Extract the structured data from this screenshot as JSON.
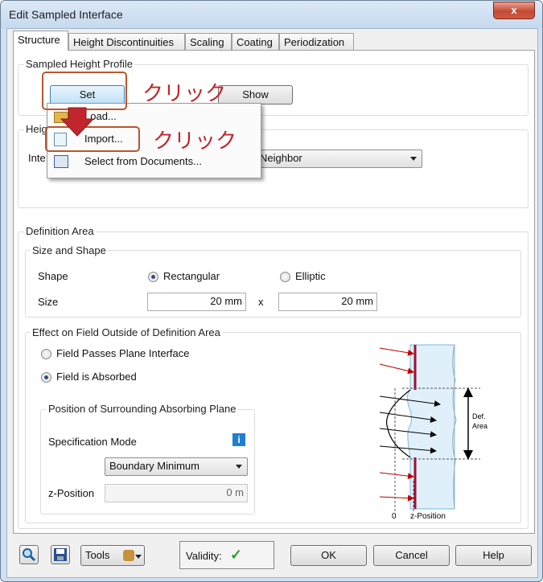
{
  "window": {
    "title": "Edit Sampled Interface",
    "close_glyph": "x"
  },
  "tabs": [
    {
      "label": "Structure"
    },
    {
      "label": "Height Discontinuities"
    },
    {
      "label": "Scaling"
    },
    {
      "label": "Coating"
    },
    {
      "label": "Periodization"
    }
  ],
  "sampled_profile": {
    "group_label": "Sampled Height Profile",
    "set_label": "Set",
    "show_label": "Show"
  },
  "height_group": {
    "label_partial": "Heig",
    "interp_label_partial": "Inte",
    "interp_value_partial": "Neighbor"
  },
  "context_menu": {
    "items": [
      {
        "label": "Load...",
        "icon": "folder-icon"
      },
      {
        "label": "Import...",
        "icon": "import-icon"
      },
      {
        "label": "Select from Documents...",
        "icon": "documents-icon"
      }
    ]
  },
  "annotations": {
    "click_text": "クリック",
    "highlight_color": "#b8562c",
    "text_color": "#c0262b"
  },
  "definition_area": {
    "group_label": "Definition Area",
    "size_shape_label": "Size and Shape",
    "shape_label": "Shape",
    "shape_options": [
      {
        "label": "Rectangular",
        "selected": true
      },
      {
        "label": "Elliptic",
        "selected": false
      }
    ],
    "size_label": "Size",
    "size_x": "20 mm",
    "times": "x",
    "size_y": "20 mm"
  },
  "effect": {
    "group_label": "Effect on Field Outside of Definition Area",
    "options": [
      {
        "label": "Field Passes Plane Interface",
        "selected": false
      },
      {
        "label": "Field is Absorbed",
        "selected": true
      }
    ],
    "position_group_label": "Position of Surrounding Absorbing Plane",
    "spec_mode_label": "Specification Mode",
    "spec_mode_value": "Boundary Minimum",
    "zpos_label": "z-Position",
    "zpos_value": "0 m"
  },
  "diagram": {
    "def_area_label_1": "Def.",
    "def_area_label_2": "Area",
    "zero_label": "0",
    "zpos_label": "z-Position"
  },
  "footer": {
    "tools_label": "Tools",
    "validity_label": "Validity:",
    "validity_mark": "✓",
    "ok_label": "OK",
    "cancel_label": "Cancel",
    "help_label": "Help"
  }
}
